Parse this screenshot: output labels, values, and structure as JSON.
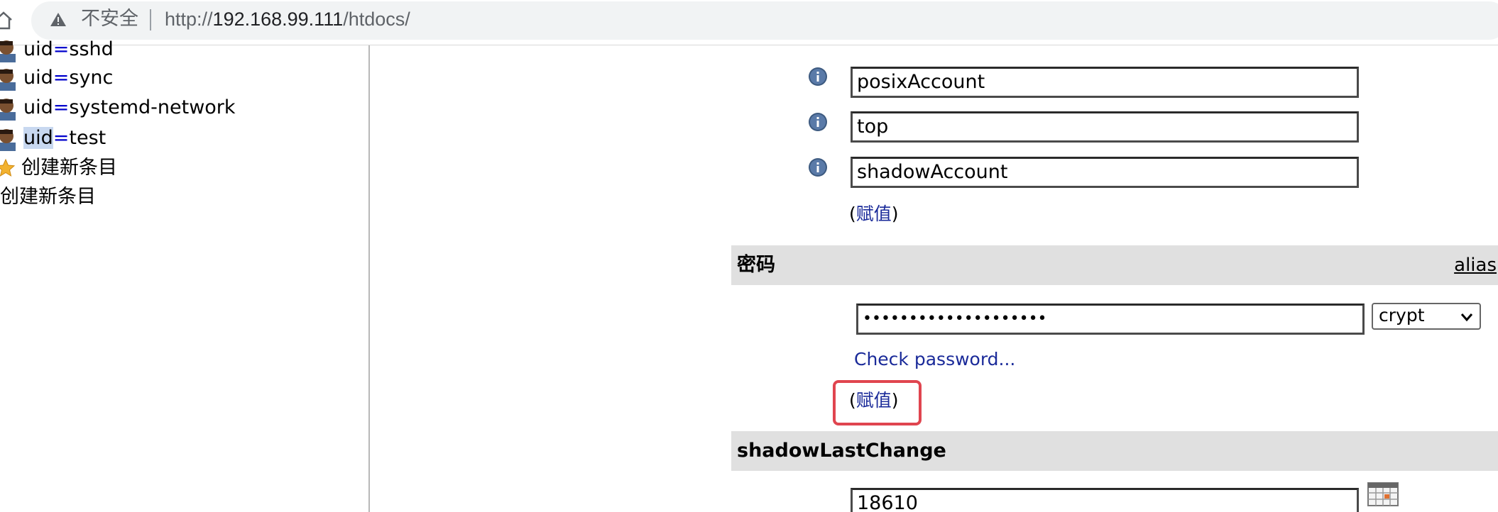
{
  "browser": {
    "security_label": "不安全",
    "url_scheme": "http://",
    "url_host": "192.168.99.111",
    "url_path": "/htdocs/"
  },
  "tree": {
    "entries": [
      {
        "prefix": "uid",
        "value": "sshd"
      },
      {
        "prefix": "uid",
        "value": "sync"
      },
      {
        "prefix": "uid",
        "value": "systemd-network"
      },
      {
        "prefix": "uid",
        "value": "test"
      }
    ],
    "create_new_icon_label": "创建新条目",
    "create_new_label": "创建新条目"
  },
  "form": {
    "objectclass_values": [
      "posixAccount",
      "top",
      "shadowAccount"
    ],
    "assign_open": "(",
    "assign_label": "赋值",
    "assign_close": ")",
    "password_section": {
      "title": "密码",
      "alias_label": "alias",
      "masked_value": "••••••••••••••••••••",
      "hash_selected": "crypt",
      "check_password_label": "Check password..."
    },
    "shadow_section": {
      "title": "shadowLastChange",
      "value": "18610"
    }
  },
  "colors": {
    "link": "#1a2a99",
    "section_bg": "#e0e0e0",
    "highlight": "#e0454f"
  }
}
